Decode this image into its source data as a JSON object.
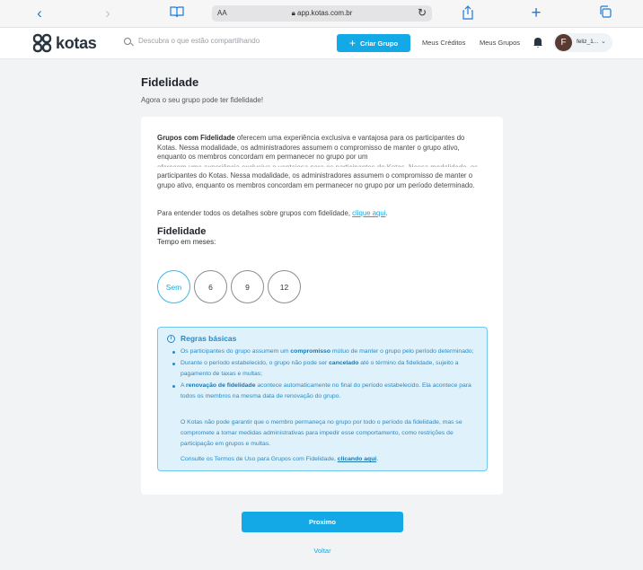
{
  "browser": {
    "aa_label": "AA",
    "url": "app.kotas.com.br"
  },
  "header": {
    "logo_text": "kotas",
    "search_placeholder": "Descubra o que estão compartilhando",
    "create_group_label": "Criar Grupo",
    "nav": [
      "Meus Créditos",
      "Meus Grupos"
    ],
    "user_initial": "F",
    "user_name": "feliz_1..."
  },
  "page": {
    "title": "Fidelidade",
    "subtitle": "Agora o seu grupo pode ter fidelidade!"
  },
  "intro": {
    "bold": "Grupos com Fidelidade",
    "text_top": " oferecem uma experiência exclusiva e vantajosa para os participantes do Kotas. Nessa modalidade, os administradores assumem o compromisso de manter o grupo ativo, enquanto os membros concordam em permanecer no grupo por um",
    "text_bottom": "participantes do Kotas. Nessa modalidade, os administradores assumem o compromisso de manter o grupo ativo, enquanto os membros concordam em permanecer no grupo por um período determinado.",
    "details_text": "Para entender todos os detalhes sobre grupos com fidelidade, ",
    "details_link": "clique aqui",
    "details_end": "."
  },
  "fidelity": {
    "title": "Fidelidade",
    "subtitle": "Tempo em meses:",
    "options": [
      "Sem",
      "6",
      "9",
      "12"
    ],
    "selected": "Sem"
  },
  "rules": {
    "title": "Regras básicas",
    "items": [
      {
        "pre": "Os participantes do grupo assumem um ",
        "bold": "compromisso",
        "post": " mútuo de manter o grupo pelo período determinado;"
      },
      {
        "pre": "Durante o período estabelecido, o grupo não pode ser ",
        "bold": "cancelado",
        "post": " até o término da fidelidade, sujeito a pagamento de taxas e multas;"
      },
      {
        "pre": "A ",
        "bold": "renovação de fidelidade",
        "post": " acontece automaticamente no final do período estabelecido. Ela acontece para todos os membros na mesma data de renovação do grupo."
      }
    ],
    "note": "O Kotas não pode garantir que o membro permaneça no grupo por todo o período da fidelidade, mas se compromete a tomar medidas administrativas para impedir esse comportamento, como restrições de participação em grupos e multas.",
    "terms_text": "Consulte os Termos de Uso para Grupos com Fidelidade, ",
    "terms_link": "clicando aqui",
    "terms_end": "."
  },
  "actions": {
    "next_label": "Proximo",
    "back_label": "Voltar"
  },
  "colors": {
    "accent": "#12a9e6",
    "info_bg": "#dff1fb",
    "info_text": "#2b89c2"
  }
}
